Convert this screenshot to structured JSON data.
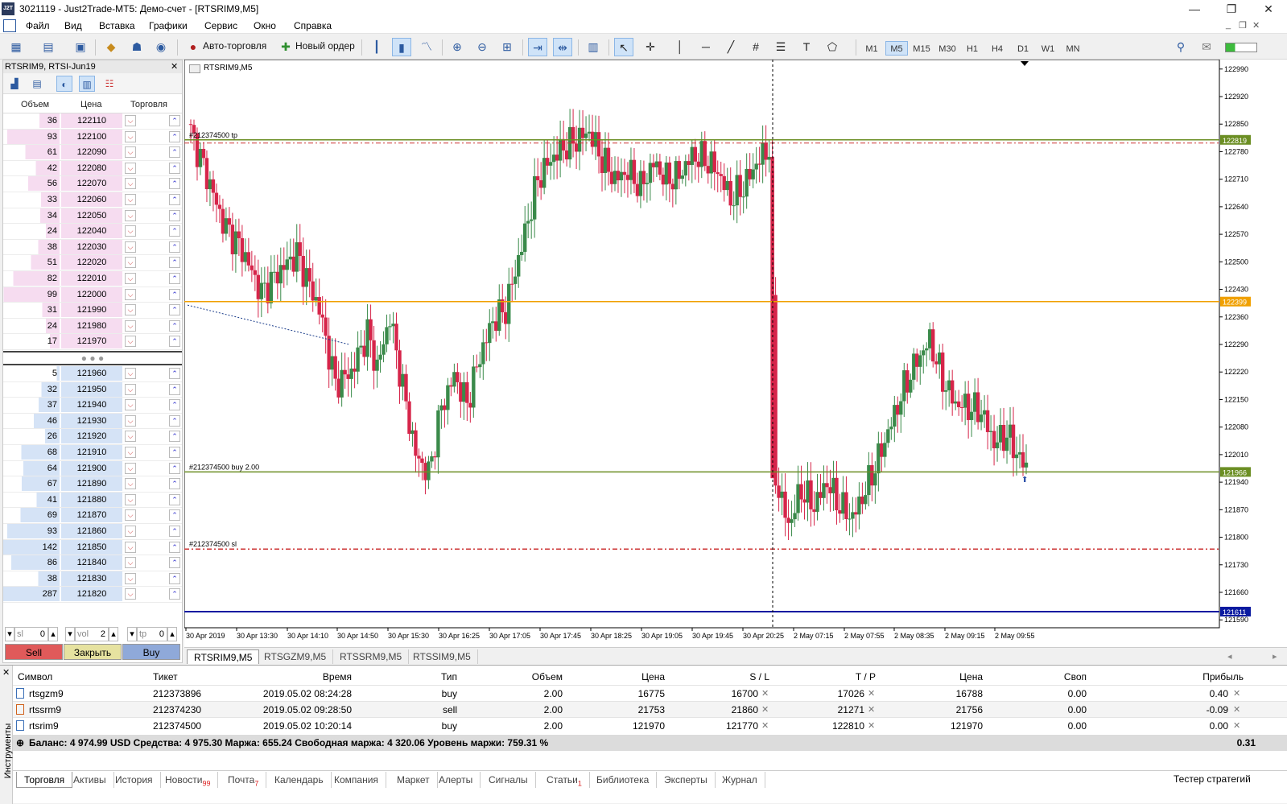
{
  "window": {
    "logo_text": "J2T",
    "title": "3021119 - Just2Trade-MT5: Демо-счет - [RTSRIM9,M5]",
    "minimize": "—",
    "maximize": "❐",
    "close": "✕"
  },
  "menu": [
    "Файл",
    "Вид",
    "Вставка",
    "Графики",
    "Сервис",
    "Окно",
    "Справка"
  ],
  "toolbar": {
    "autotrade_label": "Авто-торговля",
    "new_order_label": "Новый ордер",
    "timeframes": [
      "M1",
      "M5",
      "M15",
      "M30",
      "H1",
      "H4",
      "D1",
      "W1",
      "MN"
    ],
    "active_timeframe": "M5"
  },
  "dom": {
    "title": "RTSRIM9, RTSI-Jun19",
    "headers": {
      "volume": "Объем",
      "price": "Цена",
      "trade": "Торговля"
    },
    "asks": [
      {
        "vol": "36",
        "price": "122110"
      },
      {
        "vol": "93",
        "price": "122100"
      },
      {
        "vol": "61",
        "price": "122090"
      },
      {
        "vol": "42",
        "price": "122080"
      },
      {
        "vol": "56",
        "price": "122070"
      },
      {
        "vol": "33",
        "price": "122060"
      },
      {
        "vol": "34",
        "price": "122050"
      },
      {
        "vol": "24",
        "price": "122040"
      },
      {
        "vol": "38",
        "price": "122030"
      },
      {
        "vol": "51",
        "price": "122020"
      },
      {
        "vol": "82",
        "price": "122010"
      },
      {
        "vol": "99",
        "price": "122000"
      },
      {
        "vol": "31",
        "price": "121990"
      },
      {
        "vol": "24",
        "price": "121980"
      },
      {
        "vol": "17",
        "price": "121970"
      }
    ],
    "mid": "● ● ●",
    "bids": [
      {
        "vol": "5",
        "price": "121960"
      },
      {
        "vol": "32",
        "price": "121950"
      },
      {
        "vol": "37",
        "price": "121940"
      },
      {
        "vol": "46",
        "price": "121930"
      },
      {
        "vol": "26",
        "price": "121920"
      },
      {
        "vol": "68",
        "price": "121910"
      },
      {
        "vol": "64",
        "price": "121900"
      },
      {
        "vol": "67",
        "price": "121890"
      },
      {
        "vol": "41",
        "price": "121880"
      },
      {
        "vol": "69",
        "price": "121870"
      },
      {
        "vol": "93",
        "price": "121860"
      },
      {
        "vol": "142",
        "price": "121850"
      },
      {
        "vol": "86",
        "price": "121840"
      },
      {
        "vol": "38",
        "price": "121830"
      },
      {
        "vol": "287",
        "price": "121820"
      }
    ],
    "sl_label": "sl",
    "sl_value": "0",
    "vol_label": "vol",
    "vol_value": "2",
    "tp_label": "tp",
    "tp_value": "0",
    "sell_label": "Sell",
    "close_label": "Закрыть",
    "buy_label": "Buy",
    "colors": {
      "ask_bg": "#f6dcf0",
      "bid_bg": "#d5e3f6",
      "sell": "#e05a5a",
      "close": "#e6e2a0",
      "buy": "#8fa9d9"
    }
  },
  "chart": {
    "label": "RTSRIM9,M5",
    "price_ticks": [
      "122990",
      "122920",
      "122850",
      "122780",
      "122710",
      "122640",
      "122570",
      "122500",
      "122430",
      "122360",
      "122290",
      "122220",
      "122150",
      "122080",
      "122010",
      "121940",
      "121870",
      "121800",
      "121730",
      "121660",
      "121590"
    ],
    "time_ticks": [
      "30 Apr 2019",
      "30 Apr 13:30",
      "30 Apr 14:10",
      "30 Apr 14:50",
      "30 Apr 15:30",
      "30 Apr 16:25",
      "30 Apr 17:05",
      "30 Apr 17:45",
      "30 Apr 18:25",
      "30 Apr 19:05",
      "30 Apr 19:45",
      "30 Apr 20:25",
      "2 May 07:15",
      "2 May 07:55",
      "2 May 08:35",
      "2 May 09:15",
      "2 May 09:55"
    ],
    "lines": [
      {
        "name": "tp",
        "label": "#212374500 tp",
        "price": 122810,
        "color": "#6b8e23",
        "badge": "122819"
      },
      {
        "name": "level",
        "label": "",
        "price": 122399,
        "color": "#f0a000",
        "badge": "122399"
      },
      {
        "name": "buy",
        "label": "#212374500 buy 2.00",
        "price": 121966,
        "color": "#6b8e23",
        "badge": "121966"
      },
      {
        "name": "sl",
        "label": "#212374500 sl",
        "price": 121770,
        "color": "#c33",
        "badge": ""
      },
      {
        "name": "bid",
        "label": "",
        "price": 121611,
        "color": "#0a1aa0",
        "badge": "121611"
      }
    ]
  },
  "chart_tabs": [
    "RTSRIM9,M5",
    "RTSGZM9,M5",
    "RTSSRM9,M5",
    "RTSSIM9,M5"
  ],
  "terminal": {
    "side_label": "Инструменты",
    "headers": [
      "Символ",
      "Тикет",
      "Время",
      "Тип",
      "Объем",
      "Цена",
      "S / L",
      "T / P",
      "Цена",
      "Своп",
      "Прибыль"
    ],
    "rows": [
      [
        "rtsgzm9",
        "212373896",
        "2019.05.02 08:24:28",
        "buy",
        "2.00",
        "16775",
        "16700",
        "17026",
        "16788",
        "0.00",
        "0.40"
      ],
      [
        "rtssrm9",
        "212374230",
        "2019.05.02 09:28:50",
        "sell",
        "2.00",
        "21753",
        "21860",
        "21271",
        "21756",
        "0.00",
        "-0.09"
      ],
      [
        "rtsrim9",
        "212374500",
        "2019.05.02 10:20:14",
        "buy",
        "2.00",
        "121970",
        "121770",
        "122810",
        "121970",
        "0.00",
        "0.00"
      ]
    ],
    "balance_text": "Баланс: 4 974.99 USD  Средства: 4 975.30  Маржа: 655.24  Свободная маржа: 4 320.06  Уровень маржи: 759.31 %",
    "balance_profit": "0.31",
    "tabs": [
      {
        "label": "Торговля",
        "badge": ""
      },
      {
        "label": "Активы",
        "badge": ""
      },
      {
        "label": "История",
        "badge": ""
      },
      {
        "label": "Новости",
        "badge": "99"
      },
      {
        "label": "Почта",
        "badge": "7"
      },
      {
        "label": "Календарь",
        "badge": ""
      },
      {
        "label": "Компания",
        "badge": ""
      },
      {
        "label": "Маркет",
        "badge": ""
      },
      {
        "label": "Алерты",
        "badge": ""
      },
      {
        "label": "Сигналы",
        "badge": ""
      },
      {
        "label": "Статьи",
        "badge": "1"
      },
      {
        "label": "Библиотека",
        "badge": ""
      },
      {
        "label": "Эксперты",
        "badge": ""
      },
      {
        "label": "Журнал",
        "badge": ""
      }
    ],
    "strategy_tester": "Тестер стратегий"
  }
}
